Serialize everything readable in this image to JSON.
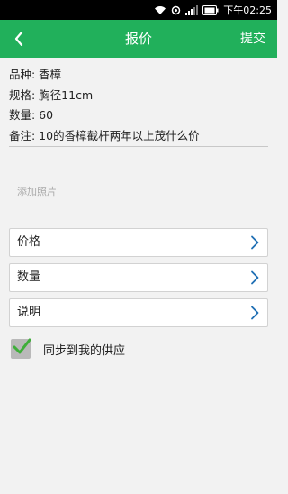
{
  "status_bar": {
    "time": "下午02:25",
    "icons": [
      "wifi-icon",
      "sync-icon",
      "signal-icon",
      "battery-icon"
    ]
  },
  "header": {
    "title": "报价",
    "submit_label": "提交",
    "background": "#21b05b"
  },
  "info": {
    "variety": "品种: 香樟",
    "spec": "规格: 胸径11cm",
    "quantity": "数量: 60",
    "note": "备注: 10的香樟截杆两年以上茂什么价"
  },
  "add_photo_label": "添加照片",
  "form": {
    "price_label": "价格",
    "quantity_label": "数量",
    "description_label": "说明"
  },
  "sync": {
    "label": "同步到我的供应",
    "checked": true
  }
}
